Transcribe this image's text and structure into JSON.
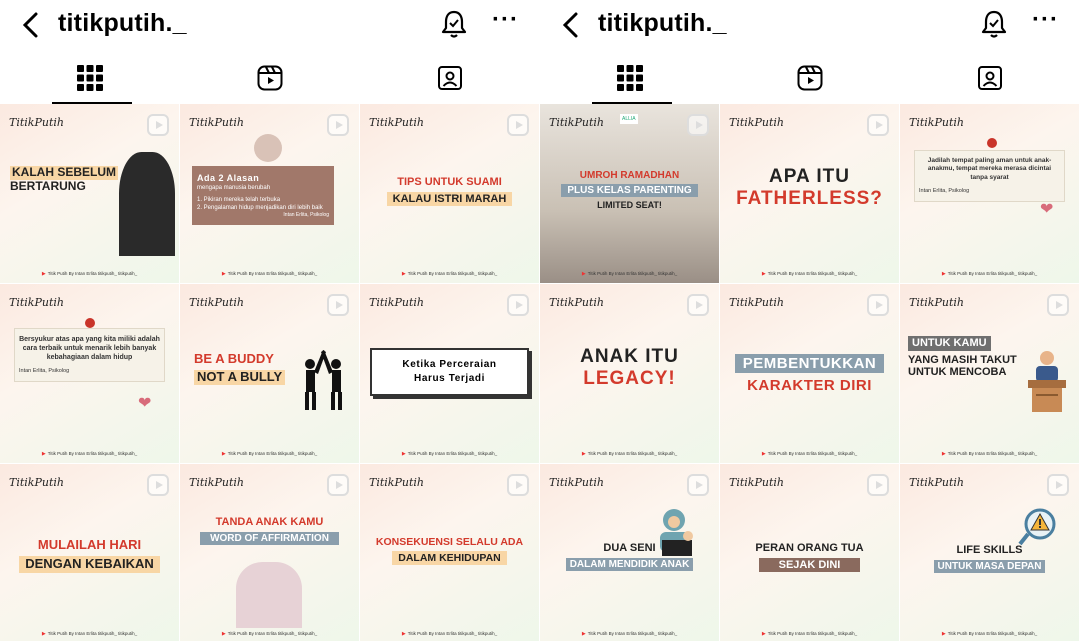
{
  "screens": [
    {
      "title": "titikputih._",
      "more": "···",
      "tiles": [
        {
          "logo": "TitikPutih",
          "headline": [
            "KALAH SEBELUM",
            "BERTARUNG"
          ],
          "footer": "Titik Putih By Intan Erlita   titikputih_   titikputih_"
        },
        {
          "logo": "TitikPutih",
          "card_title": "Ada 2 Alasan",
          "card_sub": "mengapa manusia berubah",
          "card_items": [
            "1. Pikiran mereka telah terbuka",
            "2. Pengalaman hidup menjadikan diri lebih baik"
          ],
          "card_author": "Intan Erlita, Psikolog",
          "footer": "Titik Putih By Intan Erlita   titikputih_   titikputih_"
        },
        {
          "logo": "TitikPutih",
          "headline": [
            "TIPS UNTUK SUAMI",
            "KALAU ISTRI MARAH"
          ],
          "footer": "Titik Putih By Intan Erlita   titikputih_   titikputih_"
        },
        {
          "logo": "TitikPutih",
          "note": "Bersyukur atas apa yang kita miliki adalah cara terbaik untuk menarik lebih banyak kebahagiaan dalam hidup",
          "note_author": "Intan Erlita, Psikolog",
          "footer": "Titik Putih By Intan Erlita   titikputih_   titikputih_"
        },
        {
          "logo": "TitikPutih",
          "headline": [
            "BE A BUDDY",
            "NOT A BULLY"
          ],
          "footer": "Titik Putih By Intan Erlita   titikputih_   titikputih_"
        },
        {
          "logo": "TitikPutih",
          "headline": [
            "Ketika Perceraian",
            "Harus Terjadi"
          ],
          "footer": "Titik Putih By Intan Erlita   titikputih_   titikputih_"
        },
        {
          "logo": "TitikPutih",
          "headline": [
            "MULAILAH HARI",
            "DENGAN KEBAIKAN"
          ],
          "footer": "Titik Putih By Intan Erlita   titikputih_   titikputih_"
        },
        {
          "logo": "TitikPutih",
          "headline": [
            "TANDA ANAK KAMU",
            "WORD OF AFFIRMATION"
          ],
          "footer": "Titik Putih By Intan Erlita   titikputih_   titikputih_"
        },
        {
          "logo": "TitikPutih",
          "headline": [
            "KONSEKUENSI SELALU ADA",
            "DALAM KEHIDUPAN"
          ],
          "footer": "Titik Putih By Intan Erlita   titikputih_   titikputih_"
        }
      ]
    },
    {
      "title": "titikputih._",
      "more": "···",
      "tiles": [
        {
          "logo": "TitikPutih",
          "badge": "ALLIA",
          "headline": [
            "UMROH RAMADHAN",
            "PLUS KELAS PARENTING",
            "LIMITED SEAT!"
          ],
          "footer": "Titik Putih By Intan Erlita   titikputih_   titikputih_"
        },
        {
          "logo": "TitikPutih",
          "headline": [
            "APA ITU",
            "FATHERLESS?"
          ],
          "footer": "Titik Putih By Intan Erlita   titikputih_   titikputih_"
        },
        {
          "logo": "TitikPutih",
          "note": "Jadilah tempat paling aman untuk anak-anakmu, tempat mereka merasa dicintai tanpa syarat",
          "note_author": "Intan Erlita, Psikolog",
          "footer": "Titik Putih By Intan Erlita   titikputih_   titikputih_"
        },
        {
          "logo": "TitikPutih",
          "headline": [
            "ANAK ITU",
            "LEGACY!"
          ],
          "footer": "Titik Putih By Intan Erlita   titikputih_   titikputih_"
        },
        {
          "logo": "TitikPutih",
          "headline": [
            "PEMBENTUKKAN",
            "KARAKTER DIRI"
          ],
          "footer": "Titik Putih By Intan Erlita   titikputih_   titikputih_"
        },
        {
          "logo": "TitikPutih",
          "headline": [
            "UNTUK KAMU",
            "YANG MASIH TAKUT",
            "UNTUK MENCOBA"
          ],
          "footer": "Titik Putih By Intan Erlita   titikputih_   titikputih_"
        },
        {
          "logo": "TitikPutih",
          "headline": [
            "DUA SENI",
            "DALAM MENDIDIK ANAK"
          ],
          "footer": "Titik Putih By Intan Erlita   titikputih_   titikputih_"
        },
        {
          "logo": "TitikPutih",
          "headline": [
            "PERAN ORANG TUA",
            "SEJAK DINI"
          ],
          "footer": "Titik Putih By Intan Erlita   titikputih_   titikputih_"
        },
        {
          "logo": "TitikPutih",
          "headline": [
            "LIFE SKILLS",
            "UNTUK MASA DEPAN"
          ],
          "footer": "Titik Putih By Intan Erlita   titikputih_   titikputih_"
        }
      ]
    }
  ],
  "icons": {
    "back": "chevron-left-icon",
    "notify": "bell-icon",
    "more": "more-options-icon",
    "tab_grid": "grid-icon",
    "tab_reels": "reels-icon",
    "tab_tagged": "tagged-icon"
  },
  "colors": {
    "accent_red": "#d33a2c",
    "band_peach": "#f8d6a5",
    "band_slate": "#8a9eac",
    "band_brown": "#8a6a5e"
  }
}
